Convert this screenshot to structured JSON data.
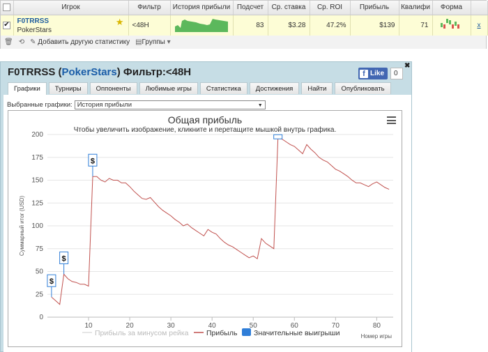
{
  "table": {
    "headers": [
      "Игрок",
      "Фильтр",
      "История прибыли",
      "Подсчет",
      "Ср. ставка",
      "Ср. ROI",
      "Прибыль",
      "Квалифи",
      "Форма"
    ],
    "row": {
      "player_name": "F0TRRSS",
      "site": "PokerStars",
      "filter": "<48H",
      "count": "83",
      "avg_stake": "$3.28",
      "avg_roi": "47.2%",
      "profit": "$139",
      "qualify": "71",
      "close_glyph": "x"
    }
  },
  "toolbar": {
    "add_stats": "Добавить другую статистику",
    "groups": "Группы"
  },
  "window": {
    "title_name": "F0TRRSS",
    "title_site": "PokerStars",
    "title_filter": "Фильтр:<48H",
    "like_label": "Like",
    "like_count": "0",
    "tabs": [
      "Графики",
      "Турниры",
      "Оппоненты",
      "Любимые игры",
      "Статистика",
      "Достижения",
      "Найти",
      "Опубликовать"
    ],
    "selected_label": "Выбранные графики:",
    "selected_value": "История прибыли"
  },
  "chart_data": {
    "type": "line",
    "title": "Общая прибыль",
    "subtitle": "Чтобы увеличить изображение, кликните и перетащите мышкой внутрь графика.",
    "xlabel": "Номер игры",
    "ylabel": "Суммарный итог (USD)",
    "xlim": [
      0,
      84
    ],
    "ylim": [
      0,
      200
    ],
    "x_ticks": [
      10,
      20,
      30,
      40,
      50,
      60,
      70,
      80
    ],
    "y_ticks": [
      0,
      25,
      50,
      75,
      100,
      125,
      150,
      175,
      200
    ],
    "grid": true,
    "legend": [
      "Прибыль за минусом рейка",
      "Прибыль",
      "Значительные выигрыши"
    ],
    "line_color": "#c0504d",
    "marker_color": "#2f7ed8",
    "markers": [
      {
        "x": 1,
        "y": 22,
        "label": "$"
      },
      {
        "x": 4,
        "y": 47,
        "label": "$"
      },
      {
        "x": 11,
        "y": 154,
        "label": "$"
      },
      {
        "x": 56,
        "y": 196,
        "label": "$"
      }
    ],
    "series": [
      {
        "name": "Прибыль",
        "points": [
          [
            1,
            22
          ],
          [
            2,
            18
          ],
          [
            3,
            14
          ],
          [
            4,
            47
          ],
          [
            5,
            42
          ],
          [
            6,
            39
          ],
          [
            7,
            38
          ],
          [
            8,
            36
          ],
          [
            9,
            36
          ],
          [
            10,
            34
          ],
          [
            11,
            154
          ],
          [
            12,
            154
          ],
          [
            13,
            150
          ],
          [
            14,
            148
          ],
          [
            15,
            152
          ],
          [
            16,
            150
          ],
          [
            17,
            150
          ],
          [
            18,
            147
          ],
          [
            19,
            147
          ],
          [
            20,
            143
          ],
          [
            21,
            138
          ],
          [
            22,
            134
          ],
          [
            23,
            130
          ],
          [
            24,
            129
          ],
          [
            25,
            131
          ],
          [
            26,
            126
          ],
          [
            27,
            121
          ],
          [
            28,
            117
          ],
          [
            29,
            114
          ],
          [
            30,
            111
          ],
          [
            31,
            107
          ],
          [
            32,
            104
          ],
          [
            33,
            100
          ],
          [
            34,
            102
          ],
          [
            35,
            98
          ],
          [
            36,
            95
          ],
          [
            37,
            92
          ],
          [
            38,
            89
          ],
          [
            39,
            96
          ],
          [
            40,
            93
          ],
          [
            41,
            91
          ],
          [
            42,
            86
          ],
          [
            43,
            82
          ],
          [
            44,
            79
          ],
          [
            45,
            77
          ],
          [
            46,
            74
          ],
          [
            47,
            71
          ],
          [
            48,
            68
          ],
          [
            49,
            65
          ],
          [
            50,
            67
          ],
          [
            51,
            64
          ],
          [
            52,
            86
          ],
          [
            53,
            81
          ],
          [
            54,
            78
          ],
          [
            55,
            75
          ],
          [
            56,
            196
          ],
          [
            57,
            195
          ],
          [
            58,
            192
          ],
          [
            59,
            189
          ],
          [
            60,
            187
          ],
          [
            61,
            183
          ],
          [
            62,
            179
          ],
          [
            63,
            189
          ],
          [
            64,
            184
          ],
          [
            65,
            180
          ],
          [
            66,
            175
          ],
          [
            67,
            172
          ],
          [
            68,
            170
          ],
          [
            69,
            166
          ],
          [
            70,
            162
          ],
          [
            71,
            160
          ],
          [
            72,
            157
          ],
          [
            73,
            154
          ],
          [
            74,
            150
          ],
          [
            75,
            147
          ],
          [
            76,
            147
          ],
          [
            77,
            145
          ],
          [
            78,
            143
          ],
          [
            79,
            146
          ],
          [
            80,
            148
          ],
          [
            81,
            145
          ],
          [
            82,
            142
          ],
          [
            83,
            140
          ]
        ]
      }
    ]
  }
}
